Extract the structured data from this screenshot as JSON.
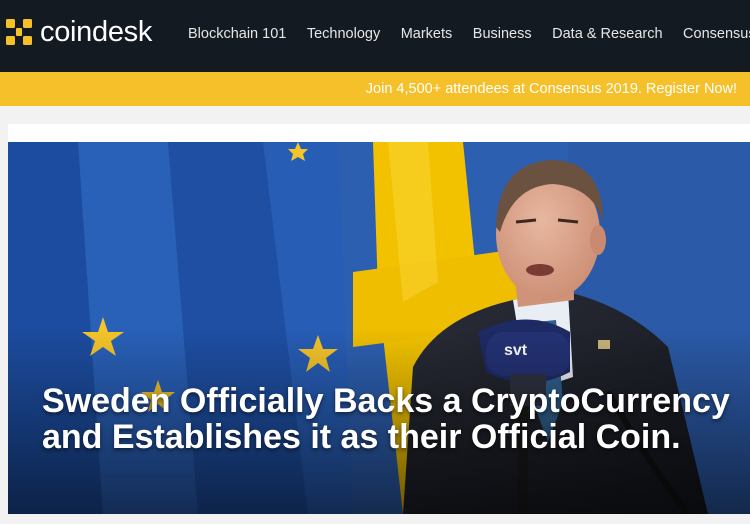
{
  "header": {
    "logo_text": "coindesk",
    "nav": [
      {
        "label": "Blockchain 101"
      },
      {
        "label": "Technology"
      },
      {
        "label": "Markets"
      },
      {
        "label": "Business"
      },
      {
        "label": "Data & Research"
      },
      {
        "label": "Consensus"
      }
    ]
  },
  "promo": {
    "text": "Join 4,500+ attendees at Consensus 2019. Register Now!"
  },
  "hero": {
    "headline": "Sweden Officially Backs a CryptoCurrency and Establishes it as their Official Coin.",
    "microphone_label": "svt"
  },
  "colors": {
    "topbar": "#131a22",
    "promo_bar": "#f6c02b",
    "eu_blue": "#1f4fa0",
    "sweden_yellow": "#f5c400"
  }
}
